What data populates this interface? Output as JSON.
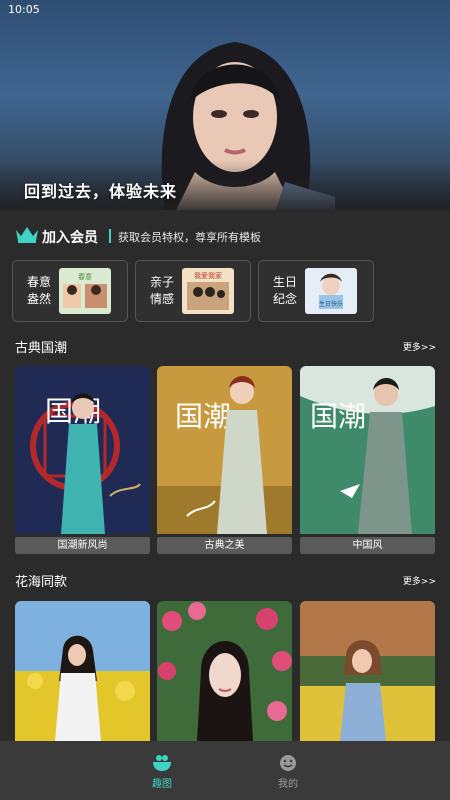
{
  "status_bar": {
    "time": "10:05"
  },
  "hero": {
    "caption": "回到过去，体验未来"
  },
  "member": {
    "title": "加入会员",
    "description": "获取会员特权，尊享所有模板",
    "accent": "#3fd3c5"
  },
  "categories": [
    {
      "label": "春意盎然",
      "thumb_text": "春意"
    },
    {
      "label": "亲子情感",
      "thumb_text": "我爱我家"
    },
    {
      "label": "生日纪念",
      "thumb_text": "生日快乐"
    }
  ],
  "section_classic": {
    "title": "古典国潮",
    "more": "更多>>",
    "items": [
      {
        "name": "国潮新风尚",
        "badge": "国潮"
      },
      {
        "name": "古典之美",
        "badge": "国潮"
      },
      {
        "name": "中国风",
        "badge": "国潮"
      }
    ]
  },
  "section_flower": {
    "title": "花海同款",
    "more": "更多>>"
  },
  "bottom_nav": [
    {
      "label": "趣图",
      "icon": "bowl-icon",
      "active": true
    },
    {
      "label": "我的",
      "icon": "smiley-icon",
      "active": false
    }
  ],
  "colors": {
    "active_tab": "#3fd3c5",
    "inactive_tab": "#9a9a9a"
  }
}
